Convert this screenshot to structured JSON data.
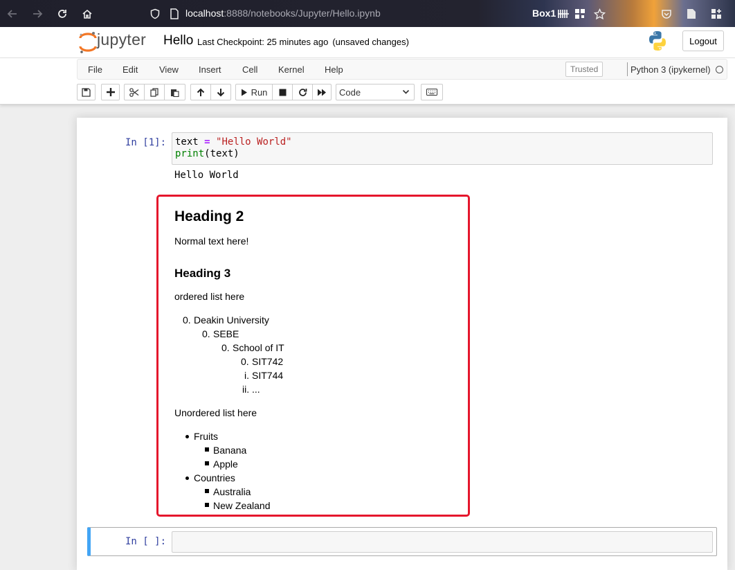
{
  "browser": {
    "url_host": "localhost",
    "url_path": ":8888/notebooks/Jupyter/Hello.ipynb",
    "extension_label": "Box1"
  },
  "header": {
    "logo_text": "jupyter",
    "notebook_name": "Hello",
    "checkpoint": "Last Checkpoint: 25 minutes ago",
    "unsaved": "(unsaved changes)",
    "logout_label": "Logout"
  },
  "menubar": {
    "items": [
      "File",
      "Edit",
      "View",
      "Insert",
      "Cell",
      "Kernel",
      "Help"
    ],
    "trusted_label": "Trusted",
    "kernel_name": "Python 3 (ipykernel)"
  },
  "toolbar": {
    "run_label": "Run",
    "cell_type": "Code",
    "icons": [
      "save-icon",
      "plus-icon",
      "cut-icon",
      "copy-icon",
      "paste-icon",
      "arrow-up-icon",
      "arrow-down-icon",
      "play-icon",
      "stop-icon",
      "restart-icon",
      "fast-forward-icon",
      "keyboard-icon"
    ]
  },
  "cells": {
    "code_cell": {
      "prompt": "In [1]:",
      "line1": {
        "var": "text",
        "op": "=",
        "str": "\"Hello World\""
      },
      "line2": {
        "builtin": "print",
        "rest": "(text)"
      },
      "output": "Hello World"
    },
    "markdown": {
      "h2": "Heading 2",
      "p1": "Normal text here!",
      "h3": "Heading 3",
      "p2": "ordered list here",
      "ordered": [
        {
          "marker": "0.",
          "text": "Deakin University"
        },
        {
          "marker": "0.",
          "text": "SEBE"
        },
        {
          "marker": "0.",
          "text": "School of IT"
        },
        {
          "marker": "0.",
          "text": "SIT742"
        },
        {
          "marker": "i.",
          "text": "SIT744"
        },
        {
          "marker": "ii.",
          "text": "..."
        }
      ],
      "p3": "Unordered list here",
      "unordered": [
        "Fruits",
        "Banana",
        "Apple",
        "Countries",
        "Australia",
        "New Zealand"
      ]
    },
    "empty_cell": {
      "prompt": "In [ ]:"
    }
  },
  "colors": {
    "prompt": "#303f9f",
    "highlight_border": "#e5162c",
    "selected_cell_bar": "#42a5f5",
    "string": "#ba2121",
    "builtin": "#008000",
    "operator": "#aa22ff"
  }
}
